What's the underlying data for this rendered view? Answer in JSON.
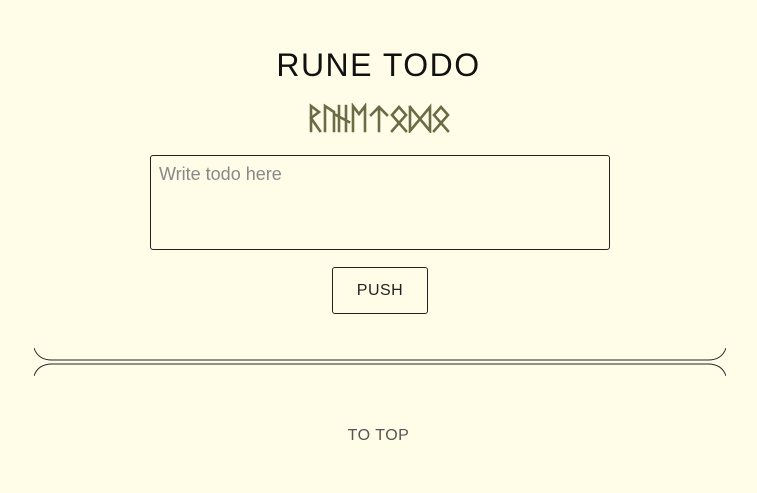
{
  "header": {
    "title": "RUNE TODO",
    "rune_subtitle": "ᚱᚢᚾᛖ ᛏᛟᛞᛟ",
    "rune_color": "#6b6b45"
  },
  "form": {
    "input_placeholder": "Write todo here",
    "input_value": "",
    "push_label": "PUSH"
  },
  "footer": {
    "to_top_label": "TO TOP"
  }
}
